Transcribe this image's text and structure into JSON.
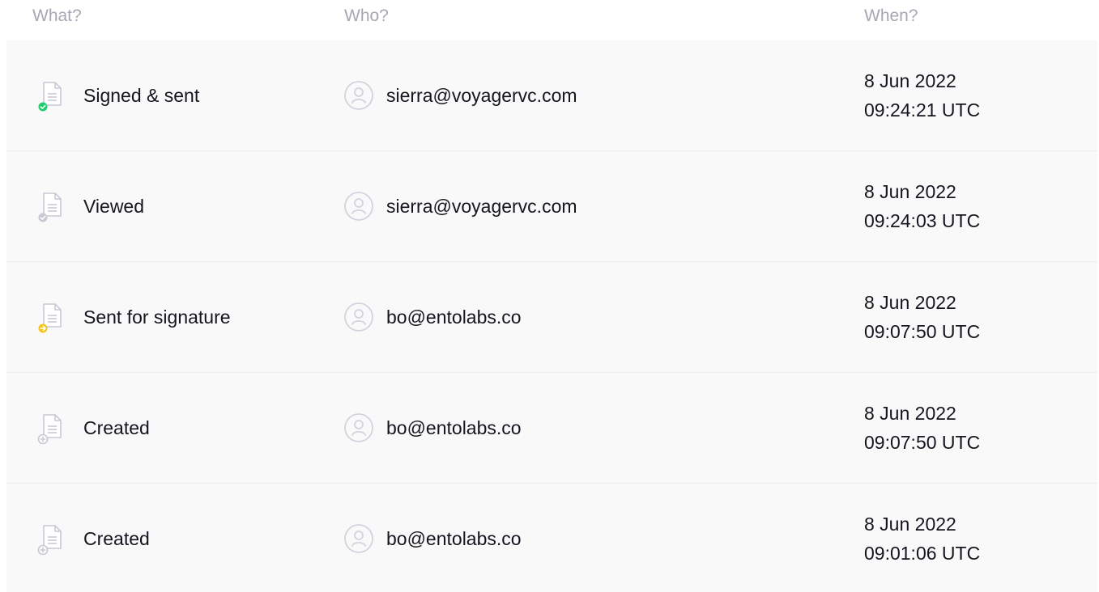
{
  "header": {
    "what": "What?",
    "who": "Who?",
    "when": "When?"
  },
  "colors": {
    "signed": "#1fcc6e",
    "viewed": "#c8c8d4",
    "sent": "#f4c51a",
    "created": "#c8c8d4"
  },
  "rows": [
    {
      "event": "Signed & sent",
      "status": "signed",
      "icon": "doc-check-icon",
      "who": "sierra@voyagervc.com",
      "date": "8 Jun 2022",
      "time": "09:24:21 UTC"
    },
    {
      "event": "Viewed",
      "status": "viewed",
      "icon": "doc-check-icon",
      "who": "sierra@voyagervc.com",
      "date": "8 Jun 2022",
      "time": "09:24:03 UTC"
    },
    {
      "event": "Sent for signature",
      "status": "sent",
      "icon": "doc-arrow-icon",
      "who": "bo@entolabs.co",
      "date": "8 Jun 2022",
      "time": "09:07:50 UTC"
    },
    {
      "event": "Created",
      "status": "created",
      "icon": "doc-plus-icon",
      "who": "bo@entolabs.co",
      "date": "8 Jun 2022",
      "time": "09:07:50 UTC"
    },
    {
      "event": "Created",
      "status": "created",
      "icon": "doc-plus-icon",
      "who": "bo@entolabs.co",
      "date": "8 Jun 2022",
      "time": "09:01:06 UTC"
    }
  ]
}
